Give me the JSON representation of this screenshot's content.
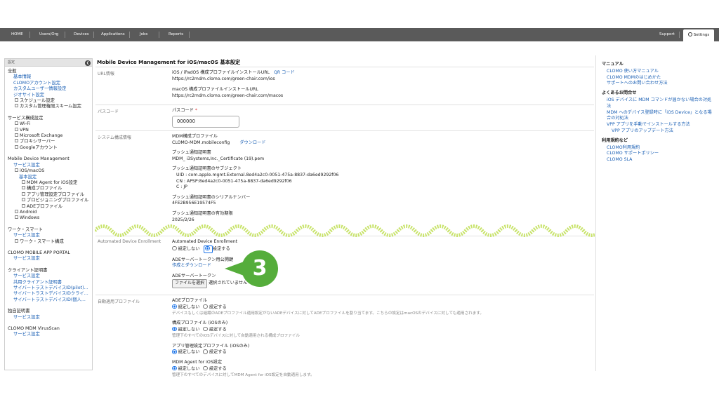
{
  "nav": {
    "home": "HOME",
    "users": "Users/Org",
    "devices": "Devices",
    "applications": "Applications",
    "jobs": "Jobs",
    "reports": "Reports",
    "support": "Support",
    "settings": "Settings"
  },
  "sidebar": {
    "header": "設定",
    "collapse_glyph": "❮",
    "general": "全般",
    "basic_info": "基本情報",
    "clomo_account": "CLOMOアカウント設定",
    "custom_user": "カスタムユーザー情報設定",
    "site_settings": "ジオサイト設定",
    "schedule": "スケジュール設定",
    "custom_perm": "カスタム管理権限スキーム設定",
    "service_config": "サービス構成設定",
    "wifi": "Wi-Fi",
    "vpn": "VPN",
    "exchange": "Microsoft Exchange",
    "proxy": "プロキシサーバー",
    "google": "Googleアカウント",
    "mdm": "Mobile Device Management",
    "mdm_service": "サービス設定",
    "ios_macos": "iOS/macOS",
    "ios_basic": "基本設定",
    "mdm_agent": "MDM Agent for iOS設定",
    "config_profile": "構成プロファイル",
    "app_profile": "アプリ管理設定プロファイル",
    "provision": "プロビジョニングプロファイル",
    "ade_profile": "ADEプロファイル",
    "android": "Android",
    "windows": "Windows",
    "worksmart": "ワーク・スマート",
    "ws_service": "サービス設定",
    "ws_config": "ワーク・スマート構成",
    "portal": "CLOMO MOBILE APP PORTAL",
    "portal_service": "サービス設定",
    "client_cert": "クライアント証明書",
    "cc_service": "サービス設定",
    "cc_shared": "共用クライアント証明書",
    "cc_trust1": "サイバートラストデバイスID(pilot)...",
    "cc_trust2": "サイバートラストデバイスIDクライ...",
    "cc_trust3": "サイバートラストデバイスID(個人...",
    "own_cert": "独自証明書",
    "own_cert_service": "サービス設定",
    "virusscan": "CLOMO MDM VirusScan",
    "vs_service": "サービス設定"
  },
  "main": {
    "title": "Mobile Device Management for iOS/macOS 基本設定",
    "url_label": "URL情報",
    "ios_url_title": "iOS / iPadOS 構成プロファイルインストールURL",
    "qr_code": "QR コード",
    "ios_url": "https://rc2mdm.clomo.com/green-chair.com/ios",
    "macos_url_title": "macOS 構成プロファイルインストールURL",
    "macos_url": "https://rc2mdm.clomo.com/green-chair.com/macos",
    "passcode_label": "パスコード",
    "passcode_title": "パスコード",
    "required_mark": "*",
    "passcode_value": "000000",
    "system_label": "システム構成情報",
    "mdm_profile_title": "MDM構成プロファイル",
    "mdm_profile_file": "CLOMO-MDM.mobileconfig",
    "download": "ダウンロード",
    "push_cert_title": "プッシュ通知証明書",
    "push_cert_file": "MDM_ i3Systems,Inc._Certificate (19).pem",
    "push_subject_title": "プッシュ通知証明書のサブジェクト",
    "uid_line": "UID   :  com.apple.mgmt.External.8ed4a2c0-0051-475a-8837-da6ed9292f06",
    "cn_line": "CN   :  APSP:8ed4a2c0-0051-475a-8837-da6ed9292f06",
    "c_line": "C     :  JP",
    "serial_title": "プッシュ通知証明書のシリアルナンバー",
    "serial_value": "4FE2B956E19574F5",
    "expiry_title": "プッシュ通知証明書の有効期限",
    "expiry_value": "2025/2/26",
    "ade_label": "Automated Device Enrollment",
    "ade_title": "Automated Device Enrollment",
    "opt_off": "設定しない",
    "opt_on": "設定する",
    "ade_key_title": "ADEサーバートークン用公開鍵",
    "ade_key_link": "作成とダウンロード",
    "ade_token_title": "ADEサーバートークン",
    "file_button": "ファイルを選択",
    "file_none": "選択されていません",
    "auto_label": "自動適用プロファイル",
    "ade_prof_title": "ADEプロファイル",
    "ade_prof_note": "デバイスもしくは組織のADEプロファイル適用設定がないADEデバイスに対してADEプロファイルを割り当てます。こちらの設定はmacOSのデバイスに対しても適用されます。",
    "cfg_prof_title": "構成プロファイル (iOSのみ)",
    "cfg_prof_note": "管理下のすべてのiOSデバイスに対して自動適用される構成プロファイル",
    "app_prof_title": "アプリ管理設定プロファイル (iOSのみ)",
    "agent_title": "MDM Agent for iOS設定",
    "agent_note": "管理下のすべてのデバイスに対してMDM Agent for iOS設定を自動適用します。"
  },
  "callout": {
    "number": "3",
    "color": "#55ad3b"
  },
  "right": {
    "manual": "マニュアル",
    "m1": "CLOMO 使い方マニュアル",
    "m2": "CLOMO MDMのはじめかた",
    "m3": "サポートへのお問い合わせ方法",
    "faq": "よくあるお問合せ",
    "f1": "iOS デバイスに MDM コマンドが届かない場合の対処法",
    "f2": "MDM へのデバイス登録時に「iOS Device」となる場合の対処法",
    "f3": "VPP アプリを手動でインストールする方法",
    "f4": "VPP アプリのアップデート方法",
    "terms": "利用規約など",
    "t1": "CLOMO利用規約",
    "t2": "CLOMO サポートポリシー",
    "t3": "CLOMO SLA"
  }
}
